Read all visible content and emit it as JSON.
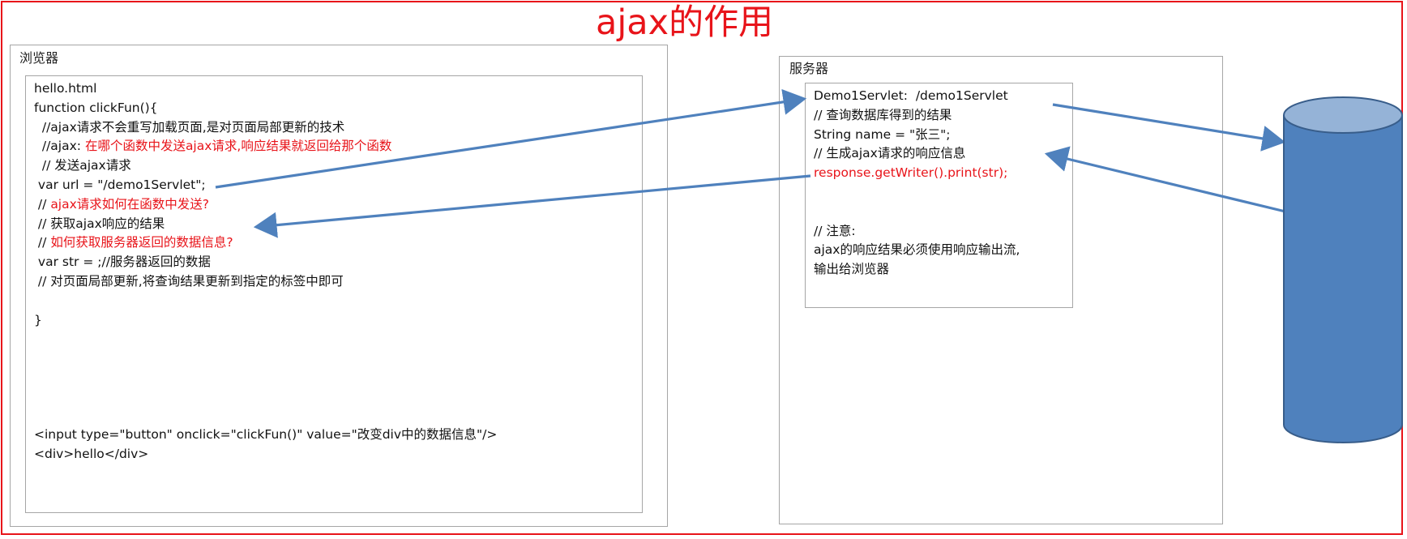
{
  "title": "ajax的作用",
  "browser": {
    "label": "浏览器",
    "code_lines": [
      {
        "parts": [
          {
            "text": "hello.html",
            "red": false
          }
        ]
      },
      {
        "parts": [
          {
            "text": "function clickFun(){",
            "red": false
          }
        ]
      },
      {
        "parts": [
          {
            "text": "  //ajax请求不会重写加载页面,是对页面局部更新的技术",
            "red": false
          }
        ]
      },
      {
        "parts": [
          {
            "text": "  //ajax: ",
            "red": false
          },
          {
            "text": "在哪个函数中发送ajax请求,响应结果就返回给那个函数",
            "red": true
          }
        ]
      },
      {
        "parts": [
          {
            "text": "  // 发送ajax请求",
            "red": false
          }
        ]
      },
      {
        "parts": [
          {
            "text": " var url = \"/demo1Servlet\";",
            "red": false
          }
        ]
      },
      {
        "parts": [
          {
            "text": " // ",
            "red": false
          },
          {
            "text": "ajax请求如何在函数中发送?",
            "red": true
          }
        ]
      },
      {
        "parts": [
          {
            "text": " // 获取ajax响应的结果",
            "red": false
          }
        ]
      },
      {
        "parts": [
          {
            "text": " // ",
            "red": false
          },
          {
            "text": "如何获取服务器返回的数据信息?",
            "red": true
          }
        ]
      },
      {
        "parts": [
          {
            "text": " var str = ;//服务器返回的数据",
            "red": false
          }
        ]
      },
      {
        "parts": [
          {
            "text": " // 对页面局部更新,将查询结果更新到指定的标签中即可",
            "red": false
          }
        ]
      },
      {
        "parts": [
          {
            "text": "",
            "red": false
          }
        ]
      },
      {
        "parts": [
          {
            "text": "}",
            "red": false
          }
        ]
      }
    ],
    "footer_lines": [
      "<input type=\"button\" onclick=\"clickFun()\" value=\"改变div中的数据信息\"/>",
      "<div>hello</div>"
    ]
  },
  "server": {
    "label": "服务器",
    "code_lines": [
      {
        "parts": [
          {
            "text": "Demo1Servlet:  /demo1Servlet",
            "red": false
          }
        ]
      },
      {
        "parts": [
          {
            "text": "// 查询数据库得到的结果",
            "red": false
          }
        ]
      },
      {
        "parts": [
          {
            "text": "String name = \"张三\";",
            "red": false
          }
        ]
      },
      {
        "parts": [
          {
            "text": "// 生成ajax请求的响应信息",
            "red": false
          }
        ]
      },
      {
        "parts": [
          {
            "text": "response.getWriter().print(str);",
            "red": true
          }
        ]
      },
      {
        "parts": [
          {
            "text": "",
            "red": false
          }
        ]
      },
      {
        "parts": [
          {
            "text": "",
            "red": false
          }
        ]
      },
      {
        "parts": [
          {
            "text": "// 注意:",
            "red": false
          }
        ]
      },
      {
        "parts": [
          {
            "text": "ajax的响应结果必须使用响应输出流,",
            "red": false
          }
        ]
      },
      {
        "parts": [
          {
            "text": "输出给浏览器",
            "red": false
          }
        ]
      }
    ]
  },
  "colors": {
    "accent_red": "#e8141a",
    "arrow_blue": "#4f81bd",
    "cylinder_fill": "#4f81bd",
    "cylinder_top": "#95b3d7",
    "cylinder_stroke": "#385d8a"
  }
}
